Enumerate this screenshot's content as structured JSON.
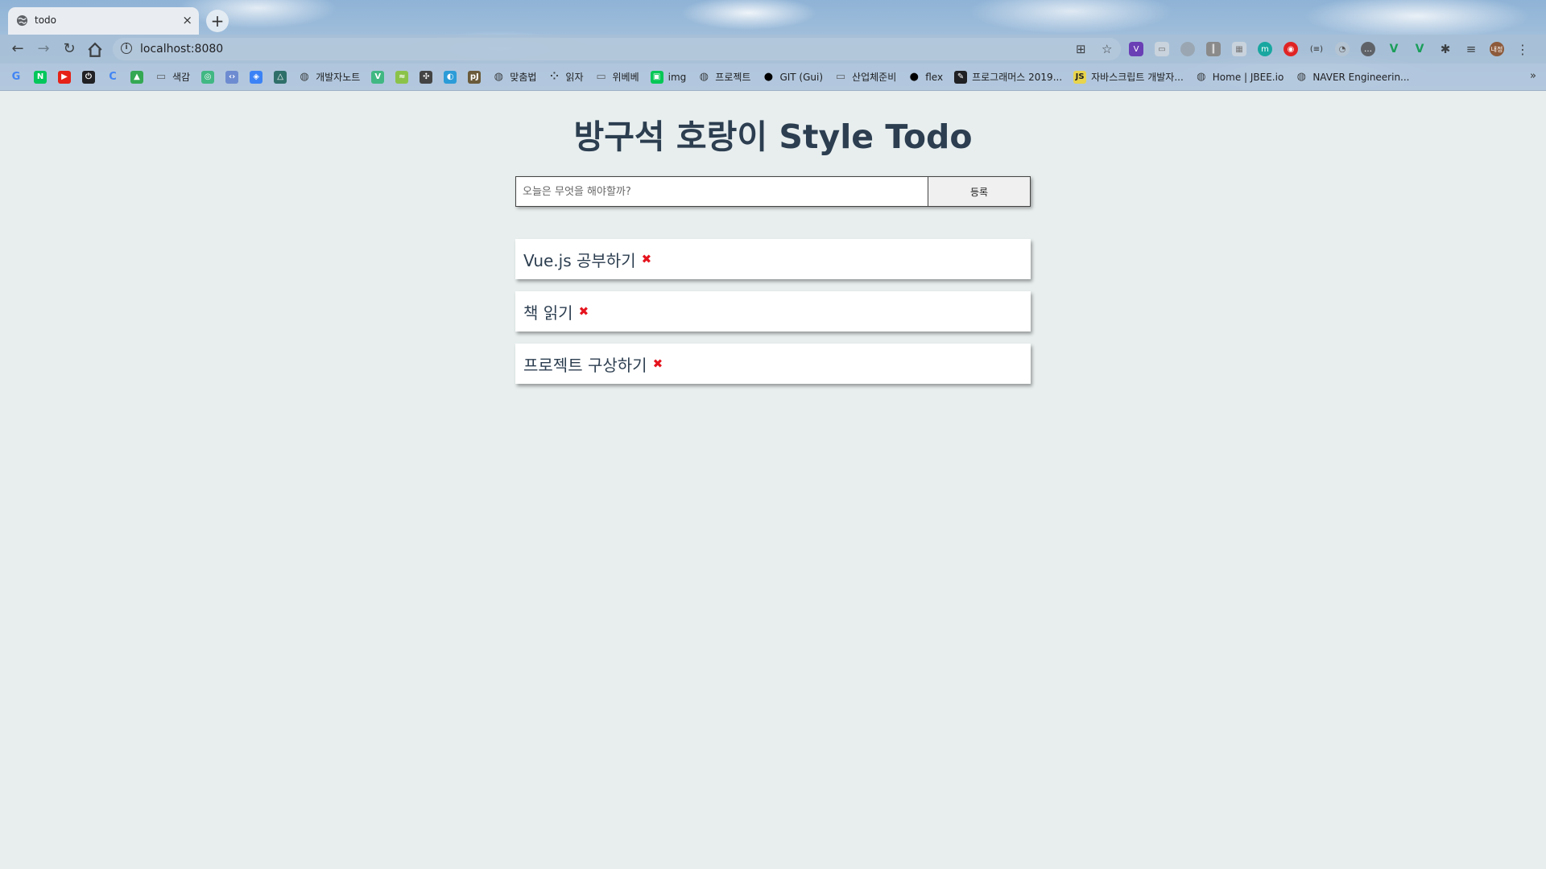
{
  "browser": {
    "tab_title": "todo",
    "tab_close": "×",
    "new_tab": "+",
    "url": "localhost:8080",
    "bookmarks": [
      {
        "label": "",
        "color": "#ffffff",
        "glyph": "G"
      },
      {
        "label": "",
        "color": "#03c75a",
        "glyph": "N"
      },
      {
        "label": "",
        "color": "#e62117",
        "glyph": "▶"
      },
      {
        "label": "",
        "color": "#202124",
        "glyph": "⏻"
      },
      {
        "label": "",
        "color": "#ffffff",
        "glyph": "C"
      },
      {
        "label": "",
        "color": "#34a853",
        "glyph": "▲"
      },
      {
        "label": "색감",
        "color": "#5f6368",
        "glyph": "▭"
      },
      {
        "label": "",
        "color": "#41b883",
        "glyph": "◎"
      },
      {
        "label": "",
        "color": "#6d8bd0",
        "glyph": "‹›"
      },
      {
        "label": "",
        "color": "#3b82f6",
        "glyph": "◈"
      },
      {
        "label": "",
        "color": "#2f6f6a",
        "glyph": "△"
      },
      {
        "label": "개발자노트",
        "color": "#3c4043",
        "glyph": "◍"
      },
      {
        "label": "",
        "color": "#41b883",
        "glyph": "V"
      },
      {
        "label": "",
        "color": "#8bc34a",
        "glyph": "≈"
      },
      {
        "label": "",
        "color": "#444444",
        "glyph": "✣"
      },
      {
        "label": "",
        "color": "#2b9cd8",
        "glyph": "◐"
      },
      {
        "label": "",
        "color": "#6b5b3a",
        "glyph": "pJ"
      },
      {
        "label": "맞춤법",
        "color": "#3c4043",
        "glyph": "◍"
      },
      {
        "label": "읽자",
        "color": "#3c4043",
        "glyph": "⁘"
      },
      {
        "label": "위베베",
        "color": "#5f6368",
        "glyph": "▭"
      },
      {
        "label": "img",
        "color": "#06c755",
        "glyph": "▣"
      },
      {
        "label": "프로젝트",
        "color": "#3c4043",
        "glyph": "◍"
      },
      {
        "label": "GIT (Gui)",
        "color": "#000000",
        "glyph": "●"
      },
      {
        "label": "산업체준비",
        "color": "#5f6368",
        "glyph": "▭"
      },
      {
        "label": "flex",
        "color": "#000000",
        "glyph": "●"
      },
      {
        "label": "프로그래머스 2019...",
        "color": "#202124",
        "glyph": "✎"
      },
      {
        "label": "자바스크립트 개발자...",
        "color": "#e8d44d",
        "glyph": "JS"
      },
      {
        "label": "Home | JBEE.io",
        "color": "#3c4043",
        "glyph": "◍"
      },
      {
        "label": "NAVER Engineerin...",
        "color": "#3c4043",
        "glyph": "◍"
      }
    ],
    "bookmarks_more": "»",
    "profile_initials": "내정"
  },
  "app": {
    "title": "방구석 호랑이 Style Todo",
    "input_placeholder": "오늘은 무엇을 해야할까?",
    "input_value": "",
    "add_button_label": "등록",
    "todos": [
      {
        "text": "Vue.js 공부하기"
      },
      {
        "text": "책 읽기"
      },
      {
        "text": "프로젝트 구상하기"
      }
    ],
    "remove_icon": "✖",
    "accent_color": "#2c3e50",
    "remove_color": "#e5141e"
  }
}
